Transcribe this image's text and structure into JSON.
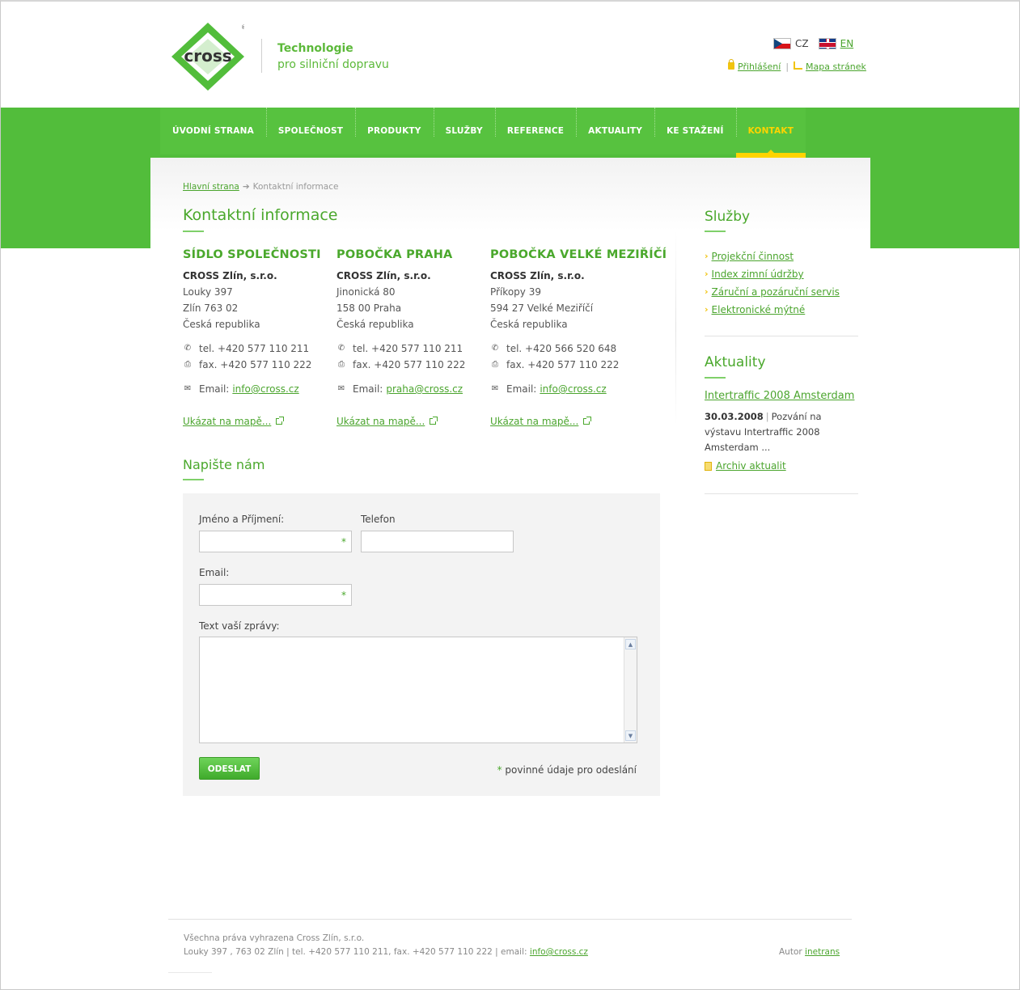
{
  "header": {
    "logo_text": "cross",
    "tagline_1": "Technologie",
    "tagline_2": "pro silniční dopravu",
    "lang_cz": "CZ",
    "lang_en": "EN",
    "login": "Přihlášení",
    "sep": "|",
    "sitemap": "Mapa stránek"
  },
  "nav": {
    "items": [
      "ÚVODNÍ STRANA",
      "SPOLEČNOST",
      "PRODUKTY",
      "SLUŽBY",
      "REFERENCE",
      "AKTUALITY",
      "KE STAŽENÍ",
      "KONTAKT"
    ],
    "active_index": 7
  },
  "breadcrumb": {
    "home": "Hlavní strana",
    "arrow": "➔",
    "current": "Kontaktní informace"
  },
  "main": {
    "title": "Kontaktní informace",
    "offices": [
      {
        "heading": "SÍDLO SPOLEČNOSTI",
        "company": "CROSS Zlín, s.r.o.",
        "line1": "Louky 397",
        "line2": "Zlín 763 02",
        "line3": "Česká republika",
        "tel": "tel. +420 577 110 211",
        "fax": "fax. +420 577 110 222",
        "email_label": "Email:",
        "email": "info@cross.cz",
        "map": "Ukázat na mapě..."
      },
      {
        "heading": "POBOČKA PRAHA",
        "company": "CROSS Zlín, s.r.o.",
        "line1": "Jinonická 80",
        "line2": "158 00 Praha",
        "line3": "Česká republika",
        "tel": "tel. +420 577 110 211",
        "fax": "fax. +420 577 110 222",
        "email_label": "Email:",
        "email": "praha@cross.cz",
        "map": "Ukázat na mapě..."
      },
      {
        "heading": "POBOČKA VELKÉ MEZIŘÍČÍ",
        "company": "CROSS Zlín, s.r.o.",
        "line1": "Příkopy 39",
        "line2": "594 27 Velké Meziříčí",
        "line3": "Česká republika",
        "tel": "tel. +420 566 520 648",
        "fax": "fax. +420 577 110 222",
        "email_label": "Email:",
        "email": "info@cross.cz",
        "map": "Ukázat na mapě..."
      }
    ],
    "form_title": "Napište nám",
    "form": {
      "name_label": "Jméno a Příjmení:",
      "phone_label": "Telefon",
      "email_label": "Email:",
      "message_label": "Text vaší zprávy:",
      "required_mark": "*",
      "submit": "ODESLAT",
      "required_note": "povinné údaje pro odeslání"
    }
  },
  "sidebar": {
    "services_title": "Služby",
    "services": [
      "Projekční činnost",
      "Index zimní údržby",
      "Záruční a pozáruční servis",
      "Elektronické mýtné"
    ],
    "news_title": "Aktuality",
    "news_headline": "Intertraffic 2008 Amsterdam",
    "news_date": "30.03.2008",
    "news_sep": "|",
    "news_text": "Pozvání na výstavu Intertraffic 2008 Amsterdam ...",
    "archive": "Archiv aktualit"
  },
  "footer": {
    "rights": "Všechna práva vyhrazena Cross Zlín, s.r.o.",
    "address": "Louky 397 , 763 02 Zlín | tel. +420 577 110 211, fax. +420 577 110 222 | email:",
    "email": "info@cross.cz",
    "author_label": "Autor",
    "author": "inetrans"
  },
  "colors": {
    "brand_green": "#52bd3b",
    "accent_yellow": "#ffd400",
    "link_green": "#4ba52e"
  }
}
